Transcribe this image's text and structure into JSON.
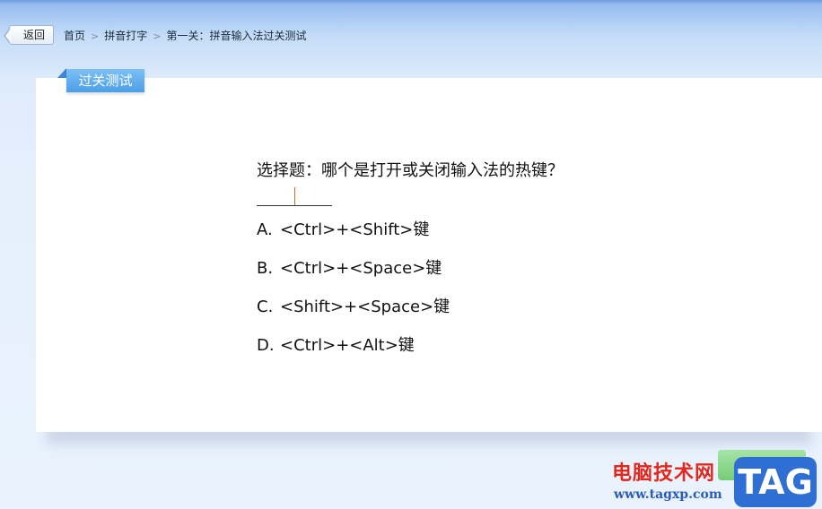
{
  "nav": {
    "back_label": "返回",
    "breadcrumb": [
      "首页",
      "拼音打字",
      "第一关：拼音输入法过关测试"
    ],
    "separator": ">"
  },
  "section": {
    "title": "过关测试"
  },
  "question": {
    "text": "选择题：哪个是打开或关闭输入法的热键？",
    "options": [
      {
        "letter": "A.",
        "text": "<Ctrl>+<Shift>键"
      },
      {
        "letter": "B.",
        "text": "<Ctrl>+<Space>键"
      },
      {
        "letter": "C.",
        "text": "<Shift>+<Space>键"
      },
      {
        "letter": "D.",
        "text": "<Ctrl>+<Alt>键"
      }
    ]
  },
  "watermark": {
    "title": "电脑技术网",
    "url": "www.tagxp.com",
    "logo_text": "TAG"
  },
  "colors": {
    "accent": "#4c9fe6",
    "watermark_red": "#e0281e",
    "watermark_blue": "#2f6ed3"
  }
}
